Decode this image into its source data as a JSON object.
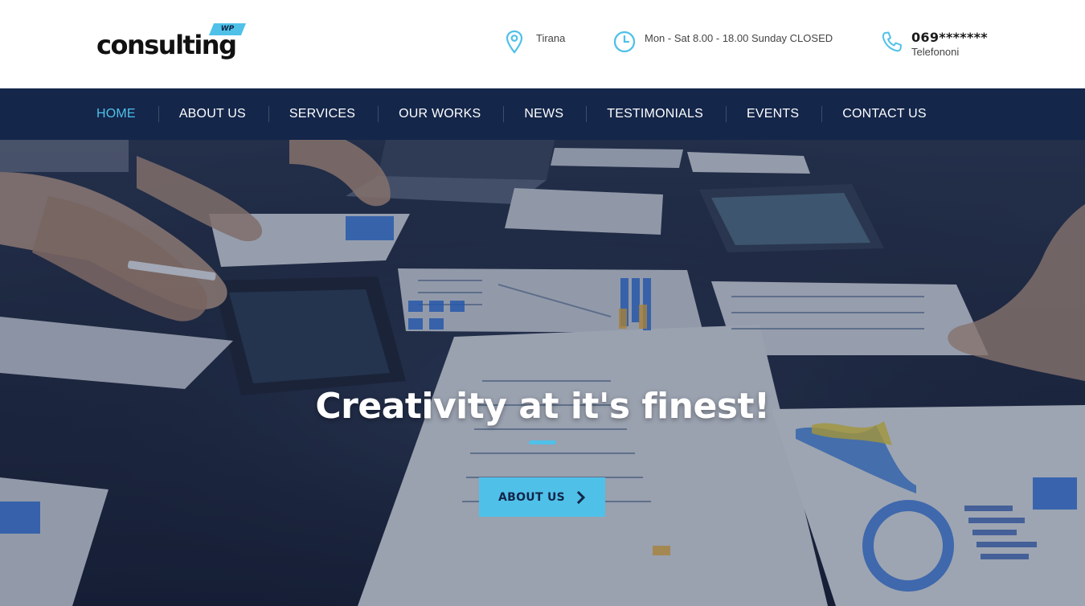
{
  "header": {
    "logo_text": "consulting",
    "logo_badge": "WP",
    "location": {
      "icon": "map-pin-icon",
      "text": "Tirana"
    },
    "hours": {
      "icon": "clock-icon",
      "text": "Mon - Sat 8.00 - 18.00 Sunday CLOSED"
    },
    "phone": {
      "icon": "phone-icon",
      "number": "069*******",
      "label": "Telefononi"
    }
  },
  "nav": {
    "items": [
      {
        "label": "HOME",
        "active": true
      },
      {
        "label": "ABOUT US"
      },
      {
        "label": "SERVICES"
      },
      {
        "label": "OUR WORKS"
      },
      {
        "label": "NEWS"
      },
      {
        "label": "TESTIMONIALS"
      },
      {
        "label": "EVENTS"
      },
      {
        "label": "CONTACT US"
      }
    ]
  },
  "hero": {
    "title": "Creativity at it's finest!",
    "button_label": "ABOUT US",
    "button_icon": "chevron-right-icon"
  },
  "colors": {
    "accent": "#4fc1e9",
    "nav_bg": "#14264a",
    "header_bg": "#ffffff"
  }
}
